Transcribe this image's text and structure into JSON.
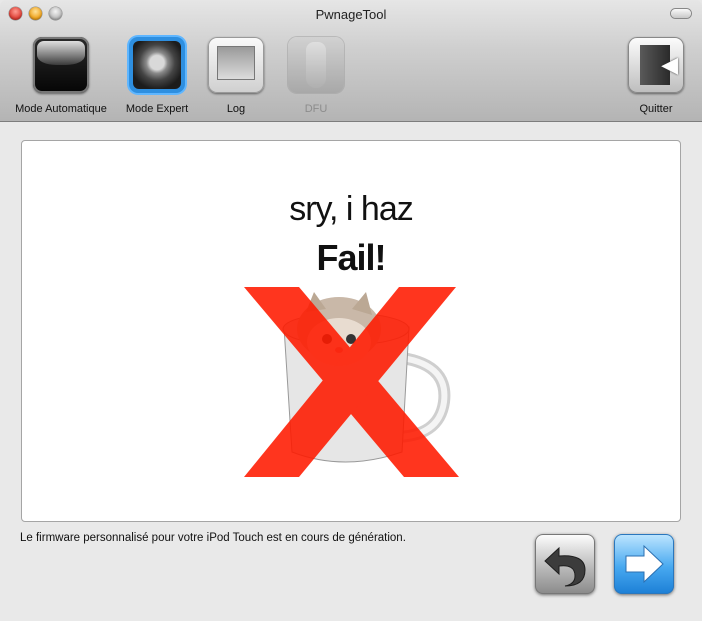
{
  "window": {
    "title": "PwnageTool"
  },
  "toolbar": {
    "items": [
      {
        "label": "Mode Automatique",
        "icon": "glossy-black-button-icon",
        "enabled": true
      },
      {
        "label": "Mode Expert",
        "icon": "einstein-portrait-icon",
        "enabled": true,
        "selected": true
      },
      {
        "label": "Log",
        "icon": "log-screen-icon",
        "enabled": true
      },
      {
        "label": "DFU",
        "icon": "hand-holding-cable-icon",
        "enabled": false
      },
      {
        "label": "Quitter",
        "icon": "exit-door-icon",
        "enabled": true
      }
    ]
  },
  "main": {
    "headline": "sry, i haz",
    "headline_bold": "Fail!",
    "image": "kitten-in-mug-with-red-x",
    "status_message": "Le firmware personnalisé pour votre iPod Touch est en cours de génération."
  },
  "navigation": {
    "back_icon": "undo-arrow-icon",
    "next_icon": "right-arrow-icon"
  },
  "colors": {
    "fail_x": "#ff1a00",
    "selected_highlight": "#2e8fe0",
    "next_button": "#3aa2ee"
  }
}
